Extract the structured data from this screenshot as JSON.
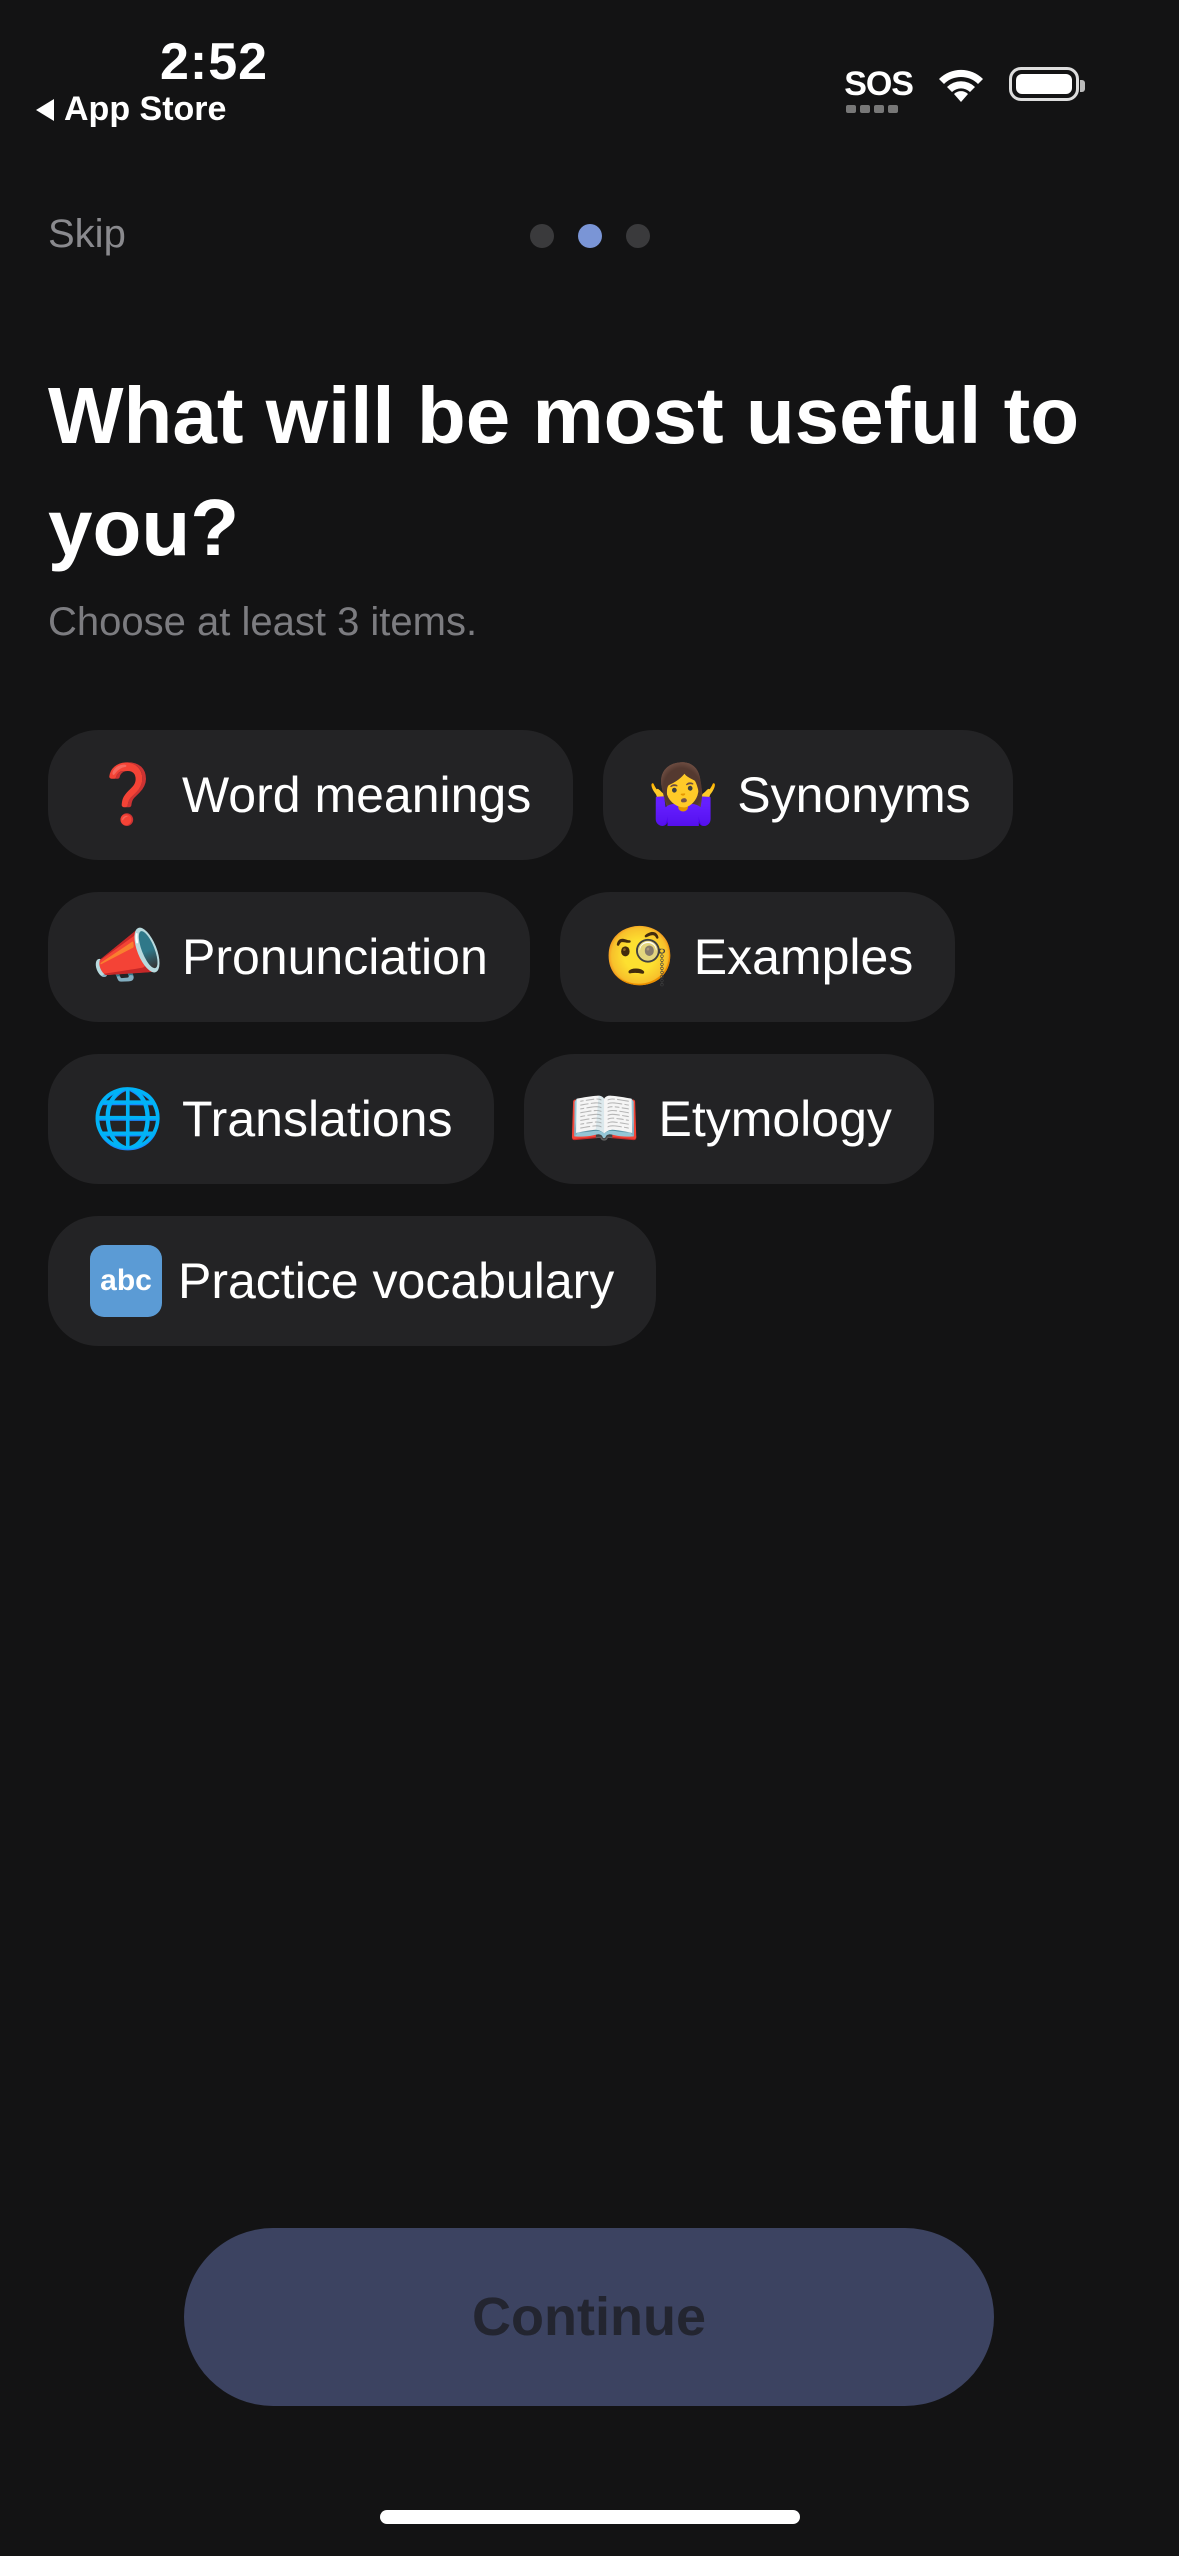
{
  "status_bar": {
    "time": "2:52",
    "back_label": "App Store",
    "sos_label": "SOS"
  },
  "header": {
    "skip_label": "Skip",
    "pager": {
      "count": 3,
      "active_index": 1
    }
  },
  "main": {
    "title": "What will be most useful to you?",
    "subtitle": "Choose at least 3 items.",
    "options": [
      {
        "emoji": "❓",
        "icon": "question-mark-icon",
        "label": "Word meanings"
      },
      {
        "emoji": "🤷‍♀️",
        "icon": "shrug-icon",
        "label": "Synonyms"
      },
      {
        "emoji": "📣",
        "icon": "megaphone-icon",
        "label": "Pronunciation"
      },
      {
        "emoji": "🧐",
        "icon": "monocle-face-icon",
        "label": "Examples"
      },
      {
        "emoji": "🌐",
        "icon": "globe-icon",
        "label": "Translations"
      },
      {
        "emoji": "📖",
        "icon": "open-book-icon",
        "label": "Etymology"
      },
      {
        "emoji": "abc",
        "icon": "abc-icon",
        "label": "Practice vocabulary"
      }
    ]
  },
  "footer": {
    "continue_label": "Continue"
  },
  "colors": {
    "background": "#131314",
    "chip": "#232325",
    "accent_dot": "#7a95d6",
    "button_disabled": "#3c4361"
  }
}
